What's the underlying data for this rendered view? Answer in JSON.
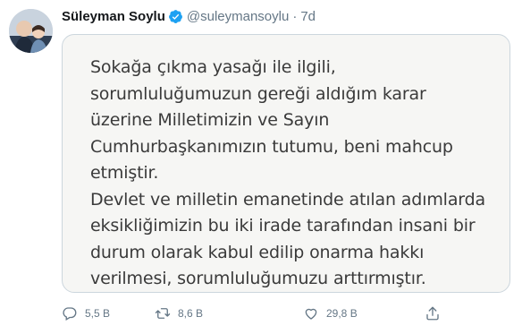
{
  "author": {
    "display_name": "Süleyman Soylu",
    "handle": "@suleymansoylu",
    "separator": "·",
    "time": "7d",
    "verified": true
  },
  "image_card": {
    "text": "Sokağa çıkma yasağı ile ilgili,\nsorumluluğumuzun gereği aldığım karar\nüzerine Milletimizin ve Sayın\nCumhurbaşkanımızın tutumu, beni mahcup\netmiştir.\nDevlet ve milletin emanetinde atılan adımlarda\neksikliğimizin bu iki irade tarafından insani bir\ndurum olarak kabul edilip onarma hakkı\nverilmesi, sorumluluğumuzu arttırmıştır."
  },
  "actions": {
    "reply": {
      "icon": "reply-icon",
      "count": "5,5 B"
    },
    "retweet": {
      "icon": "retweet-icon",
      "count": "8,6 B"
    },
    "like": {
      "icon": "heart-icon",
      "count": "29,8 B"
    },
    "share": {
      "icon": "share-icon"
    }
  },
  "colors": {
    "verified": "#1da1f2",
    "secondary_text": "#657786",
    "primary_text": "#14171a",
    "card_border": "#ccd6dd"
  }
}
